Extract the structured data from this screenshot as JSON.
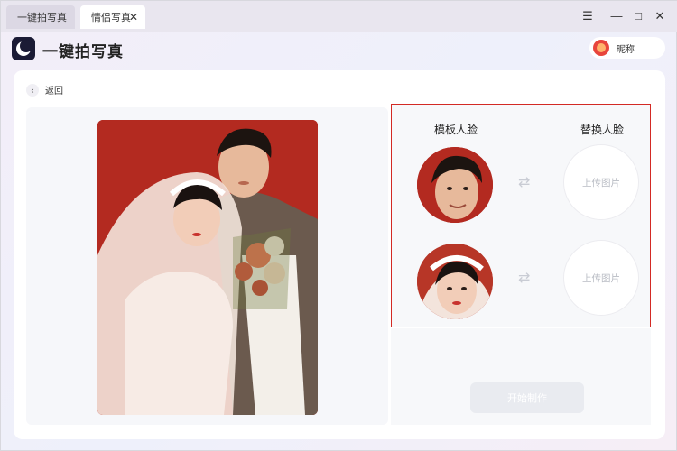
{
  "tabs": [
    {
      "label": "一键拍写真",
      "active": false
    },
    {
      "label": "情侣写真",
      "active": true
    }
  ],
  "window_controls": {
    "menu": "☰",
    "minimize": "—",
    "maximize": "□",
    "close": "✕"
  },
  "app": {
    "title": "一键拍写真",
    "logo_icon": "crescent-moon-icon"
  },
  "user": {
    "name": "昵称"
  },
  "nav": {
    "back_label": "返回"
  },
  "faces": {
    "template_header": "模板人脸",
    "replace_header": "替换人脸",
    "rows": [
      {
        "template": "male-face",
        "upload_label": "上传图片"
      },
      {
        "template": "female-face",
        "upload_label": "上传图片"
      }
    ]
  },
  "actions": {
    "start_label": "开始制作"
  },
  "colors": {
    "accent_red": "#d32a24",
    "photo_background": "#b32a20",
    "logo_bg": "#1b1b35"
  }
}
